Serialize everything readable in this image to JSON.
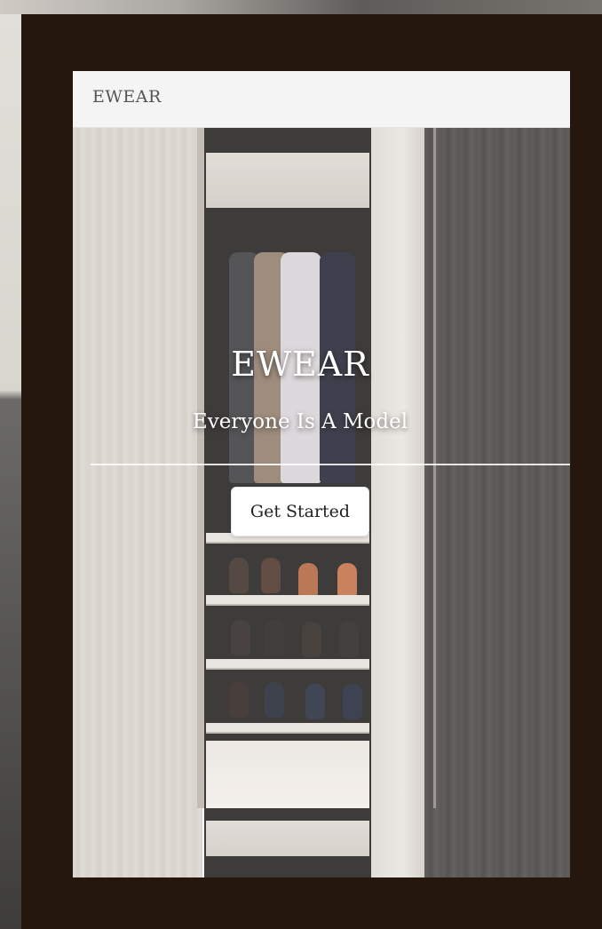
{
  "navbar": {
    "brand": "EWEAR"
  },
  "hero": {
    "title": "EWEAR",
    "subtitle": "Everyone Is A Model",
    "cta_label": "Get Started",
    "background_image": "wardrobe-photo"
  },
  "colors": {
    "frame": "#25170e",
    "navbar_bg": "#f4f4f4",
    "brand_text": "#555555",
    "hero_text": "#ffffff",
    "button_bg": "#ffffff",
    "button_text": "#222222"
  }
}
